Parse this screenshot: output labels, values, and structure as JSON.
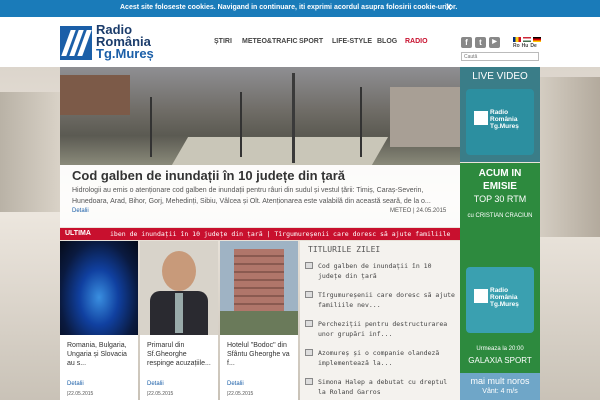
{
  "cookie": {
    "message": "Acest site foloseste cookies. Navigand in continuare, iti exprimi acordul asupra folosirii cookie-urilor.",
    "close": "X"
  },
  "logo": {
    "line1": "Radio",
    "line2": "România",
    "line3": "Tg.Mureș"
  },
  "nav": [
    {
      "label": "ȘTIRI"
    },
    {
      "label": "METEO&TRAFIC"
    },
    {
      "label": "SPORT"
    },
    {
      "label": "LIFE-STYLE"
    },
    {
      "label": "BLOG"
    },
    {
      "label": "RADIO"
    }
  ],
  "social": [
    "f",
    "t",
    "▶"
  ],
  "languages": [
    "Ro",
    "Hu",
    "De"
  ],
  "search": {
    "placeholder": "Caută"
  },
  "featured": {
    "title": "Cod galben de inundații în 10 județe din țară",
    "description": "Hidrologii au emis o atenționare cod galben de inundații pentru râuri din sudul și vestul țării: Timiș, Caraș-Severin, Hunedoara, Arad, Bihor, Gorj, Mehedinți, Sibiu, Vâlcea și Olt. Atenționarea este valabilă din această seară, de la o...",
    "more": "Detalii",
    "meta": "METEO | 24.05.2015"
  },
  "ticker": {
    "label": "ULTIMA",
    "text": "iben de inundații în 10 județe din țară  |  Tîrgumureșenii care doresc să ajute familiile"
  },
  "cards": [
    {
      "title": "Romania, Bulgaria, Ungaria și Slovacia au s...",
      "more": "Detalii",
      "date": "|22.05.2015"
    },
    {
      "title": "Primarul din Sf.Gheorghe respinge acuzațiile...",
      "more": "Detalii",
      "date": "|22.05.2015"
    },
    {
      "title": "Hotelul \"Bodoc\" din Sfântu Gheorghe va f...",
      "more": "Detalii",
      "date": "|22.05.2015"
    }
  ],
  "titluri": {
    "header": "TITLURILE ZILEI",
    "items": [
      "Cod galben de inundații în 10 județe din țară",
      "Tîrgumureșenii care doresc să ajute familiile nev...",
      "Percheziții pentru destructurarea unor grupări inf...",
      "Azomureș și o companie olandeză implementează la...",
      "Simona Halep a debutat cu dreptul la Roland Garros"
    ]
  },
  "sidebar": {
    "live": "LIVE VIDEO",
    "radio_name": [
      "Radio",
      "România",
      "Tg.Mureș"
    ],
    "on_air_line1": "ACUM IN",
    "on_air_line2": "EMISIE",
    "show": "TOP 30 RTM",
    "with": "cu CRISTIAN CRACIUN",
    "next": "Urmeaza la 20:00",
    "next_show": "GALAXIA SPORT",
    "weather": "mai mult noros",
    "wind": "Vânt: 4 m/s"
  },
  "colors": {
    "cookie_bar": "#1a7bb9",
    "brand": "#1b5fa8",
    "accent": "#c8102e",
    "live": "#3a7d88",
    "on_air": "#2d8a3e"
  }
}
